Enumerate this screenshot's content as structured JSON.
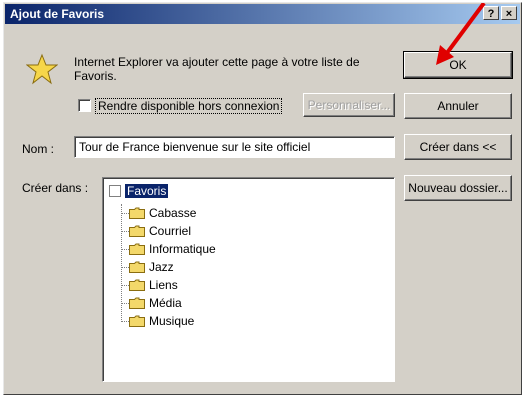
{
  "dialog": {
    "title": "Ajout de Favoris",
    "help_button": "?",
    "close_button": "×"
  },
  "message": "Internet Explorer va ajouter cette page à votre liste de Favoris.",
  "offline_checkbox": {
    "label": "Rendre disponible hors connexion",
    "checked": false
  },
  "buttons": {
    "ok": "OK",
    "cancel": "Annuler",
    "create_in": "Créer dans <<",
    "new_folder": "Nouveau dossier...",
    "customize": "Personnaliser..."
  },
  "name_field": {
    "label": "Nom :",
    "value": "Tour de France  bienvenue sur le site officiel"
  },
  "create_in": {
    "label": "Créer dans :",
    "root": "Favoris",
    "folders": [
      "Cabasse",
      "Courriel",
      "Informatique",
      "Jazz",
      "Liens",
      "Média",
      "Musique"
    ]
  },
  "annotation": {
    "arrow_color": "#e00000"
  }
}
